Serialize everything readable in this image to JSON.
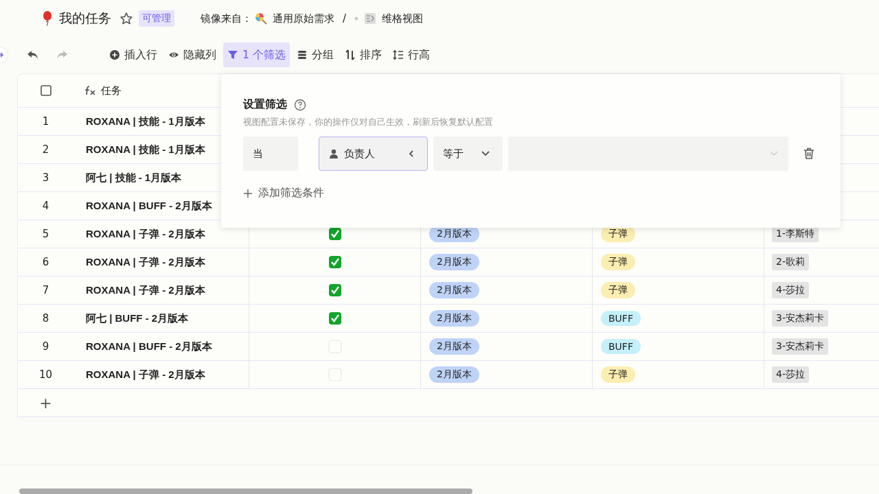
{
  "header": {
    "title": "我的任务",
    "badge": "可管理",
    "mirror_label": "镜像来自：",
    "source": "通用原始需求",
    "separator": "/",
    "view": "维格视图"
  },
  "toolbar": [
    {
      "kind": "insert",
      "label": "插入行",
      "selected": false
    },
    {
      "kind": "hide",
      "label": "隐藏列",
      "selected": false
    },
    {
      "kind": "filter",
      "label": "1 个筛选",
      "selected": true
    },
    {
      "kind": "group",
      "label": "分组",
      "selected": false
    },
    {
      "kind": "sort",
      "label": "排序",
      "selected": false
    },
    {
      "kind": "height",
      "label": "行高",
      "selected": false
    }
  ],
  "table": {
    "columns": [
      {
        "kind": "task",
        "label": "任务"
      }
    ],
    "rows": [
      {
        "index": "1",
        "task": "ROXANA | 技能 - 1月版本"
      },
      {
        "index": "2",
        "task": "ROXANA | 技能 - 1月版本"
      },
      {
        "index": "3",
        "task": "阿七 | 技能 - 1月版本"
      },
      {
        "index": "4",
        "task": "ROXANA | BUFF - 2月版本"
      },
      {
        "index": "5",
        "task": "ROXANA | 子弹 - 2月版本",
        "checked": true,
        "version": "2月版本",
        "type": {
          "label": "子弹",
          "color": "#fbeeb0"
        },
        "owner": "1-李斯特"
      },
      {
        "index": "6",
        "task": "ROXANA | 子弹 - 2月版本",
        "checked": true,
        "version": "2月版本",
        "type": {
          "label": "子弹",
          "color": "#fbeeb0"
        },
        "owner": "2-歌莉"
      },
      {
        "index": "7",
        "task": "ROXANA | 子弹 - 2月版本",
        "checked": true,
        "version": "2月版本",
        "type": {
          "label": "子弹",
          "color": "#fbeeb0"
        },
        "owner": "4-莎拉"
      },
      {
        "index": "8",
        "task": "阿七 | BUFF - 2月版本",
        "checked": true,
        "version": "2月版本",
        "type": {
          "label": "BUFF",
          "color": "#c4f0fb"
        },
        "owner": "3-安杰莉卡"
      },
      {
        "index": "9",
        "task": "ROXANA | BUFF - 2月版本",
        "checked": false,
        "version": "2月版本",
        "type": {
          "label": "BUFF",
          "color": "#c4f0fb"
        },
        "owner": "3-安杰莉卡"
      },
      {
        "index": "10",
        "task": "ROXANA | 子弹 - 2月版本",
        "checked": false,
        "version": "2月版本",
        "type": {
          "label": "子弹",
          "color": "#fbeeb0"
        },
        "owner": "4-莎拉"
      }
    ],
    "add_row": "+"
  },
  "filter_popover": {
    "title": "设置筛选",
    "hint": "视图配置未保存，你的操作仅对自己生效，刷新后恢复默认配置",
    "condition": {
      "prefix": "当",
      "field": "负责人",
      "operator": "等于"
    },
    "add": "添加筛选条件"
  }
}
